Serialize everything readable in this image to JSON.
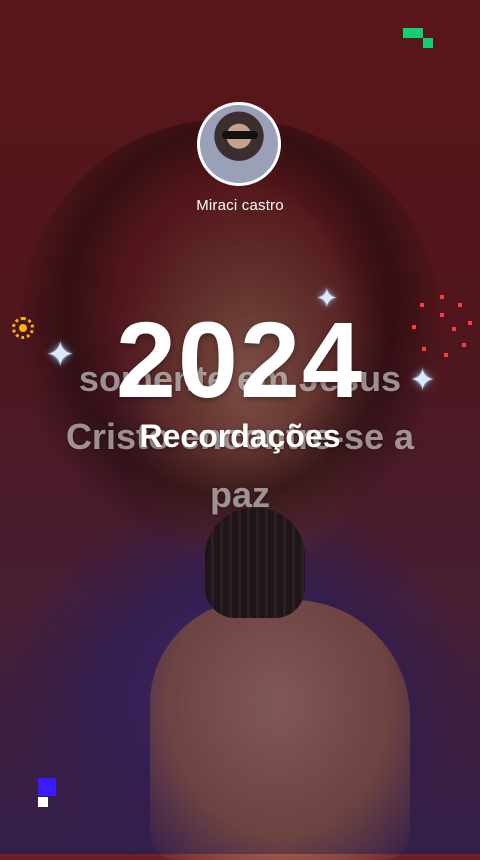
{
  "profile": {
    "username": "Miraci castro"
  },
  "video_subtitle": {
    "line1": "somente em Jesus",
    "line2": "Cristo encontre-se a",
    "line3": "paz"
  },
  "recap": {
    "year": "2024",
    "caption": "Recordações"
  },
  "colors": {
    "background": "#6e1f24",
    "sparkle": "#dbe9ff",
    "sun": "#f5b312",
    "burst": "#ff3b3b",
    "pixel_green": "#10d070",
    "pixel_blue": "#3a1bff"
  },
  "icons": [
    "sparkle-icon",
    "sun-icon",
    "firework-burst-icon",
    "pixel-decoration"
  ]
}
